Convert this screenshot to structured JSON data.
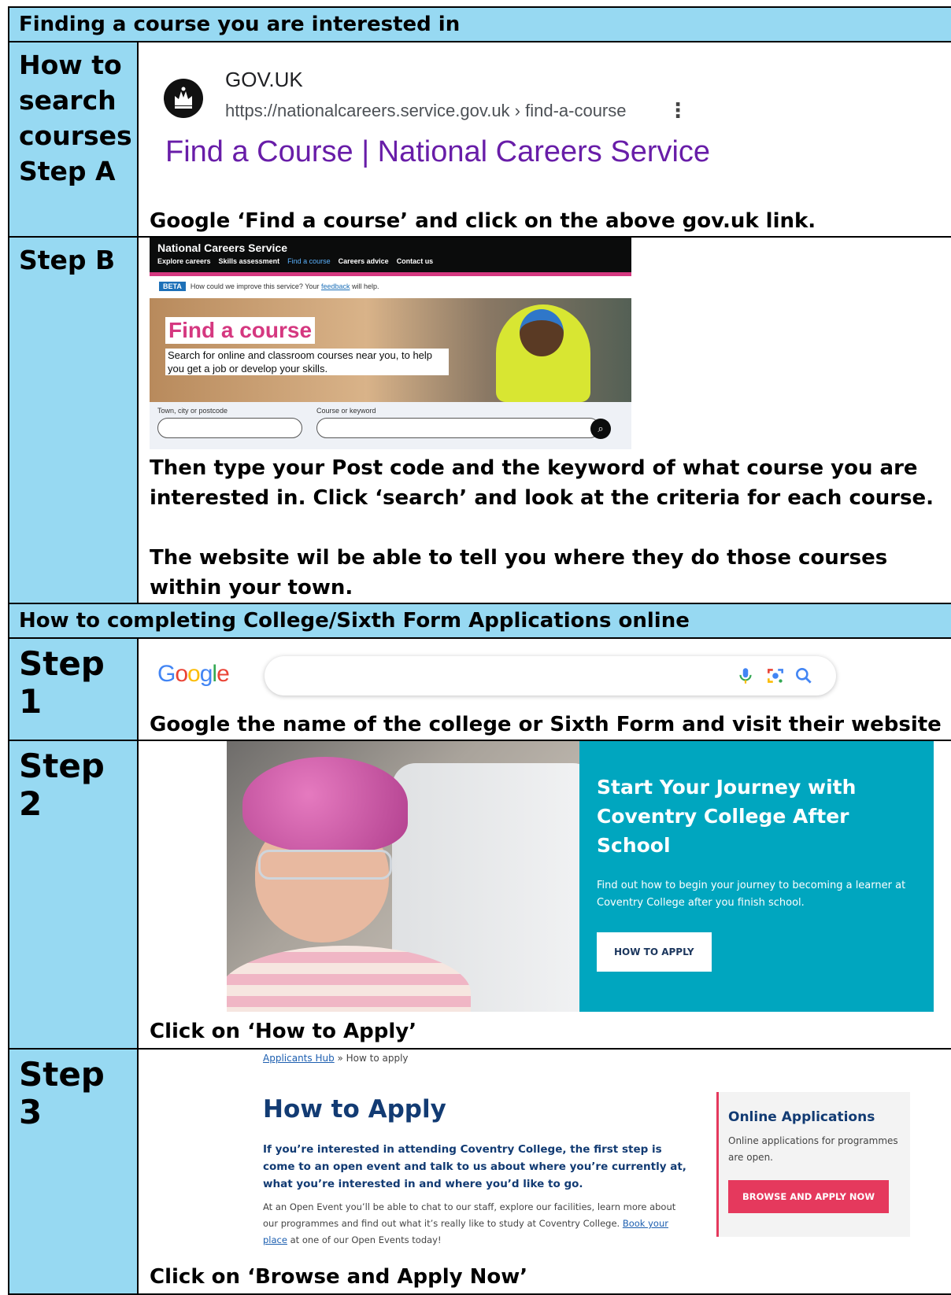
{
  "section1": {
    "header": "Finding a course you are interested in",
    "stepA": {
      "label_lines": [
        "How to",
        "search",
        "courses",
        "Step A"
      ],
      "site_name": "GOV.UK",
      "url": "https://nationalcareers.service.gov.uk › find-a-course",
      "page_title": "Find a Course | National Careers Service",
      "instruction": "Google ‘Find a course’ and click on the above gov.uk link."
    },
    "stepB": {
      "label": "Step B",
      "ncs": {
        "brand": "National Careers Service",
        "nav": [
          "Explore careers",
          "Skills assessment",
          "Find a course",
          "Careers advice",
          "Contact us"
        ],
        "beta_tag": "BETA",
        "beta_text": "How could we improve this service? Your",
        "beta_link": "feedback",
        "beta_after": "will help.",
        "hero_title": "Find a course",
        "hero_desc": "Search for online and classroom courses near you, to help you get a job or develop your skills.",
        "field1_label": "Town, city or postcode",
        "field2_label": "Course or keyword"
      },
      "instruction1": "Then type your Post code and the keyword of what course you are interested in. Click ‘search’ and look at the criteria for each course.",
      "instruction2": "The website wil be able to tell you where they do those courses within your town."
    }
  },
  "section2": {
    "header": "How to completing College/Sixth Form Applications online",
    "step1": {
      "label": "Step 1",
      "logo_letters": [
        "G",
        "o",
        "o",
        "g",
        "l",
        "e"
      ],
      "instruction": "Google the name of the college or Sixth Form and visit their website"
    },
    "step2": {
      "label": "Step 2",
      "heading": "Start Your Journey with Coventry College After School",
      "text": "Find out how to begin your journey to becoming a learner at Coventry College after you finish school.",
      "button": "HOW TO APPLY",
      "instruction": "Click on ‘How to Apply’"
    },
    "step3": {
      "label": "Step 3",
      "crumb_link": "Applicants Hub",
      "crumb_rest": " » How to apply",
      "title": "How to Apply",
      "lead": "If you’re interested in attending Coventry College, the first step is come to an open event and talk to us about where you’re currently at, what you’re interested in and where you’d like to go.",
      "body_before": "At an Open Event you’ll be able to chat to our staff, explore our facilities, learn more about our programmes and find out what it’s really like to study at Coventry College. ",
      "body_link": "Book your place",
      "body_after": " at one of our Open Events today!",
      "card_title": "Online Applications",
      "card_text": "Online applications for programmes are open.",
      "card_button": "BROWSE AND APPLY NOW",
      "instruction": "Click on ‘Browse and Apply Now’"
    }
  },
  "colors": {
    "cell_blue": "#97d9f2",
    "coventry_teal": "#00a6bf",
    "coventry_navy": "#123b73",
    "coventry_pink": "#e5395d",
    "gov_link_purple": "#681da8"
  }
}
